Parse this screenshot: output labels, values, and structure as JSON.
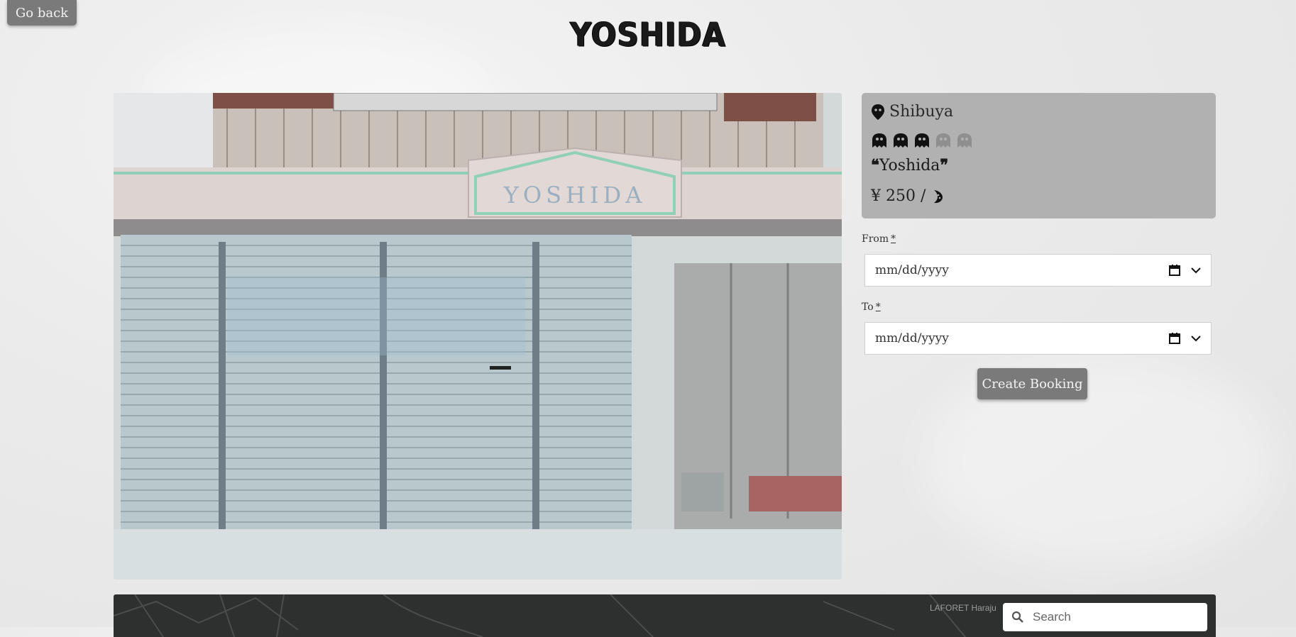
{
  "nav": {
    "back_label": "Go back"
  },
  "header": {
    "title": "YOSHIDA"
  },
  "photo": {
    "sign_text": "YOSHIDA",
    "alt": "photo-of-shop"
  },
  "listing": {
    "location": "Shibuya",
    "rating": {
      "value": 3,
      "max": 5
    },
    "name_open_quote": "❝",
    "name": "Yoshida",
    "name_close_quote": "❞",
    "price": "¥ 250 /",
    "price_unit_icon": "moon-icon"
  },
  "booking": {
    "from_label": "From",
    "to_label": "To",
    "required_mark": "*",
    "from_value": "mm/dd/yyyy",
    "to_value": "mm/dd/yyyy",
    "submit_label": "Create Booking"
  },
  "map": {
    "place_label": "LAFORET Haraju",
    "search_placeholder": "Search"
  },
  "colors": {
    "card_bg": "#b1b1b1",
    "button_bg": "#7a7a7a",
    "map_bg": "#2e2f2f"
  }
}
